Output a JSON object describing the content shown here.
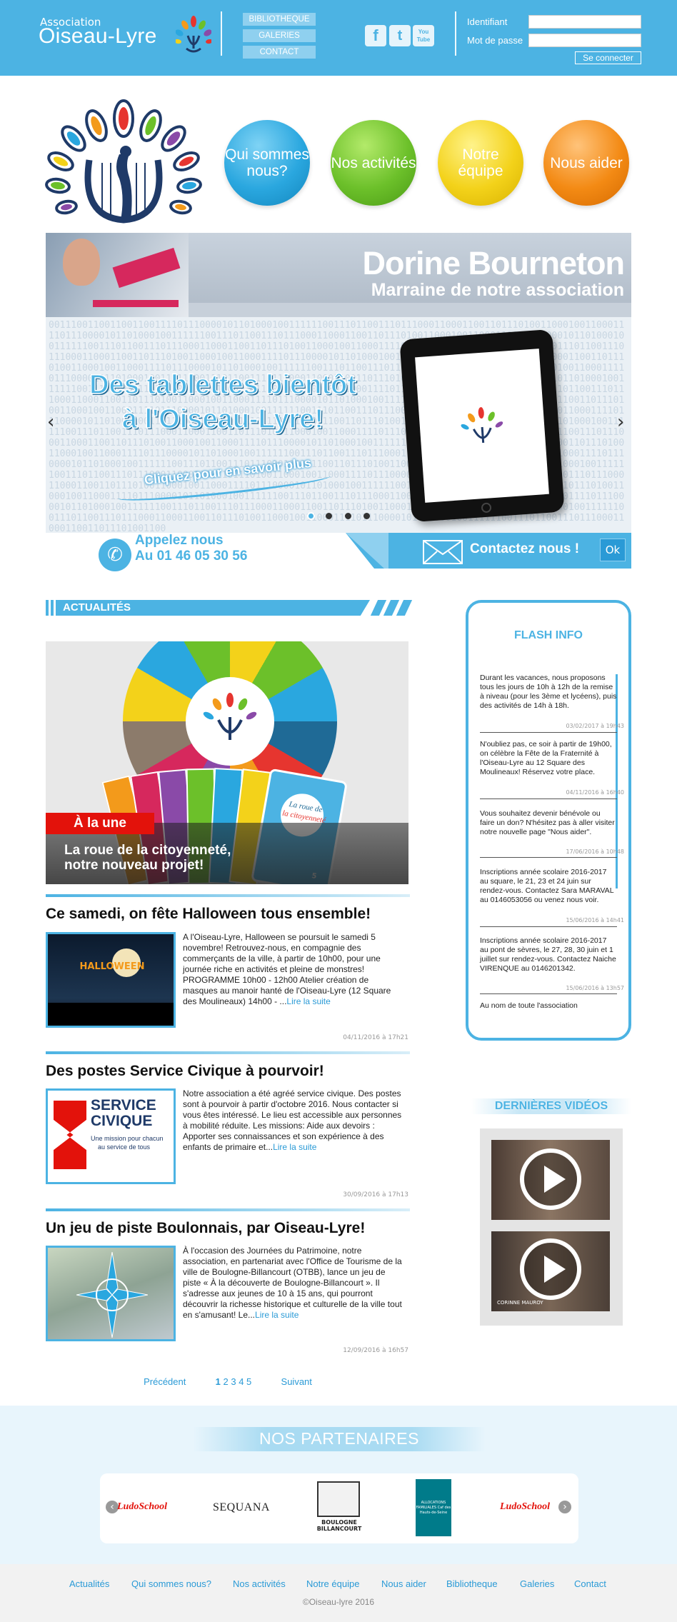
{
  "header": {
    "assoc_label": "Association",
    "brand": "Oiseau-Lyre",
    "nav": [
      "BIBLIOTHEQUE",
      "GALERIES",
      "CONTACT"
    ],
    "social": [
      {
        "label": "f",
        "icon": "facebook-icon"
      },
      {
        "label": "t",
        "icon": "twitter-icon"
      },
      {
        "label": "You Tube",
        "icon": "youtube-icon"
      }
    ],
    "login": {
      "identifiant_label": "Identifiant",
      "password_label": "Mot de passe",
      "button": "Se connecter"
    }
  },
  "bubbles": [
    {
      "label": "Qui sommes nous?",
      "color": "#2aa7df"
    },
    {
      "label": "Nos activités",
      "color": "#6cc02a"
    },
    {
      "label": "Notre équipe",
      "color": "#f3d21a"
    },
    {
      "label": "Nous aider",
      "color": "#f38a14"
    }
  ],
  "slider": {
    "title": "Dorine Bourneton",
    "subtitle": "Marraine de notre association",
    "headline_1": "Des tablettes bientôt",
    "headline_2": "à l'Oiseau-Lyre!",
    "cta": "Cliquez pour en savoir plus",
    "active_dot": 1,
    "dots": 4
  },
  "contact_bar": {
    "call_line1": "Appelez nous",
    "call_line2": "Au 01 46 05 30 56",
    "contact_label": "Contactez nous !",
    "ok_label": "Ok"
  },
  "news_section": {
    "title": "ACTUALITÉS",
    "featured_badge": "À la une",
    "featured_title_1": "La roue de la citoyenneté,",
    "featured_title_2": "notre nouveau projet!",
    "card_text_1": "La roue de",
    "card_text_2": "la citoyenneté",
    "card_number": "5",
    "items": [
      {
        "title": "Ce samedi, on fête Halloween tous ensemble!",
        "body": "A l'Oiseau-Lyre, Halloween se poursuit le samedi 5 novembre! Retrouvez-nous, en compagnie des commerçants de la ville, à partir de 10h00, pour une journée riche en activités et pleine de monstres!   PROGRAMME   10h00 - 12h00   Atelier création de masques au manoir hanté de l'Oiseau-Lyre (12 Square des Moulineaux) 14h00 - ...",
        "more": "Lire la suite",
        "date": "04/11/2016 à 17h21",
        "thumb_text": "HALLOWEEN"
      },
      {
        "title": "Des postes Service Civique à pourvoir!",
        "body": "Notre association a été agréé service civique. Des postes sont à pourvoir à partir d'octobre 2016. Nous contacter si vous êtes intéressé. Le lieu est accessible aux personnes à mobilité réduite.   Les missions:  Aide aux devoirs : Apporter ses connaissances et son expérience à des enfants de primaire et...",
        "more": "Lire la suite",
        "date": "30/09/2016 à 17h13",
        "thumb_line1": "SERVICE",
        "thumb_line2": "CIVIQUE",
        "thumb_line3": "Une mission pour chacun",
        "thumb_line4": "au service de tous"
      },
      {
        "title": "Un jeu de piste Boulonnais, par Oiseau-Lyre!",
        "body": "À l'occasion des Journées du Patrimoine, notre association, en partenariat avec l'Office de Tourisme de la ville de Boulogne-Billancourt (OTBB), lance un jeu de piste « À la découverte de Boulogne-Billancourt ».   Il s'adresse aux jeunes de 10 à 15 ans, qui pourront découvrir la richesse historique et culturelle de la ville tout en s'amusant! Le...",
        "more": "Lire la suite",
        "date": "12/09/2016 à 16h57"
      }
    ],
    "pager": {
      "prev": "Précédent",
      "pages": [
        "1",
        "2",
        "3",
        "4",
        "5"
      ],
      "next": "Suivant"
    }
  },
  "flash": {
    "title": "FLASH INFO",
    "items": [
      {
        "text": "Durant les vacances, nous proposons tous les jours de 10h à 12h de la remise à niveau (pour les 3ème et lycéens), puis des activités de 14h à 18h.",
        "date": "03/02/2017 à 19h43"
      },
      {
        "text": "N'oubliez pas, ce soir à partir de 19h00, on célèbre la Fête de la Fraternité à l'Oiseau-Lyre au 12 Square des Moulineaux! Réservez votre place.",
        "date": "04/11/2016 à 16h40"
      },
      {
        "text": "Vous souhaitez devenir bénévole ou faire un don? N'hésitez pas à aller visiter notre nouvelle page \"Nous aider\".",
        "date": "17/06/2016 à 10h48"
      },
      {
        "text": "Inscriptions année scolaire 2016-2017 au square, le 21, 23 et 24 juin sur rendez-vous. Contactez Sara MARAVAL au 0146053056 ou venez nous voir.",
        "date": "15/06/2016 à 14h41"
      },
      {
        "text": "Inscriptions année scolaire 2016-2017 au pont de sèvres, le 27, 28, 30 juin et 1 juillet sur rendez-vous. Contactez Naiche VIRENQUE au 0146201342.",
        "date": "15/06/2016 à 13h57"
      },
      {
        "text": "Au nom de toute l'association",
        "date": ""
      }
    ]
  },
  "videos": {
    "title": "DERNIÈRES VIDÉOS",
    "count": 2,
    "caption_2": "CORINNE MAUROY"
  },
  "partners": {
    "title": "NOS PARTENAIRES",
    "logos": [
      "LudoSchool",
      "SEQUANA",
      "BOULOGNE BILLANCOURT",
      "ALLOCATIONS FAMILIALES Caf des Hauts-de-Seine",
      "LudoSchool"
    ]
  },
  "footer": {
    "links": [
      "Actualités",
      "Qui sommes nous?",
      "Nos activités",
      "Notre équipe",
      "Nous aider",
      "Bibliotheque",
      "Galeries",
      "Contact"
    ],
    "copyright": "©Oiseau-lyre 2016"
  }
}
